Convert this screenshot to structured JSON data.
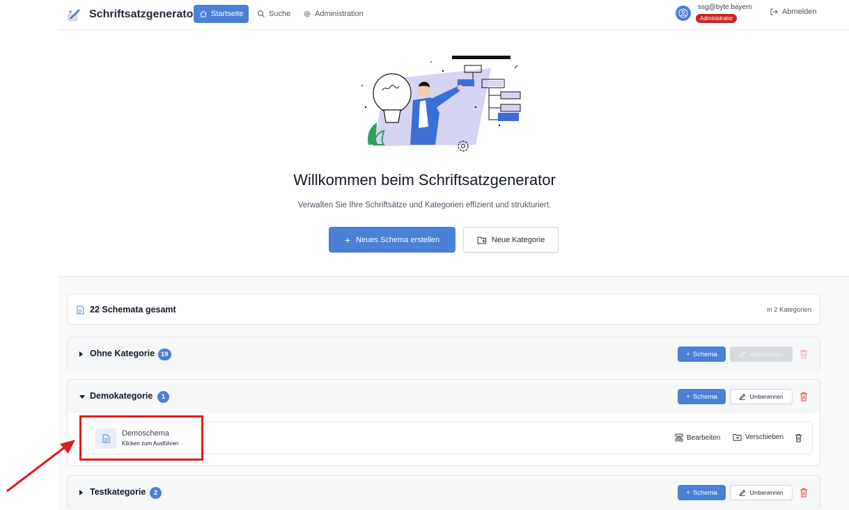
{
  "nav": {
    "app_title": "Schriftsatzgenerator",
    "home_label": "Startseite",
    "search_label": "Suche",
    "admin_label": "Administration",
    "user_email": "ssg@byte.bayern",
    "user_role": "Administrator",
    "logout_label": "Abmelden"
  },
  "hero": {
    "title": "Willkommen beim Schriftsatzgenerator",
    "subtitle": "Verwalten Sie Ihre Schriftsätze und Kategorien effizient und strukturiert.",
    "new_schema_label": "Neues Schema erstellen",
    "new_category_label": "Neue Kategorie"
  },
  "summary": {
    "total_label": "22 Schemata gesamt",
    "categories_label": "in 2 Kategorien"
  },
  "categories": [
    {
      "name": "Ohne Kategorie",
      "count": "19",
      "expanded": false,
      "rename_disabled": true
    },
    {
      "name": "Demokategorie",
      "count": "1",
      "expanded": true,
      "rename_disabled": false
    },
    {
      "name": "Testkategorie",
      "count": "2",
      "expanded": false,
      "rename_disabled": false
    }
  ],
  "category_actions": {
    "schema_label": "Schema",
    "rename_label": "Umbenennen"
  },
  "schema_item": {
    "name": "Demoschema",
    "hint": "Klicken zum Ausführen",
    "edit_label": "Bearbeiten",
    "move_label": "Verschieben"
  },
  "colors": {
    "primary": "#4a80d6",
    "danger": "#c62828",
    "annotation": "#e01b1b"
  }
}
